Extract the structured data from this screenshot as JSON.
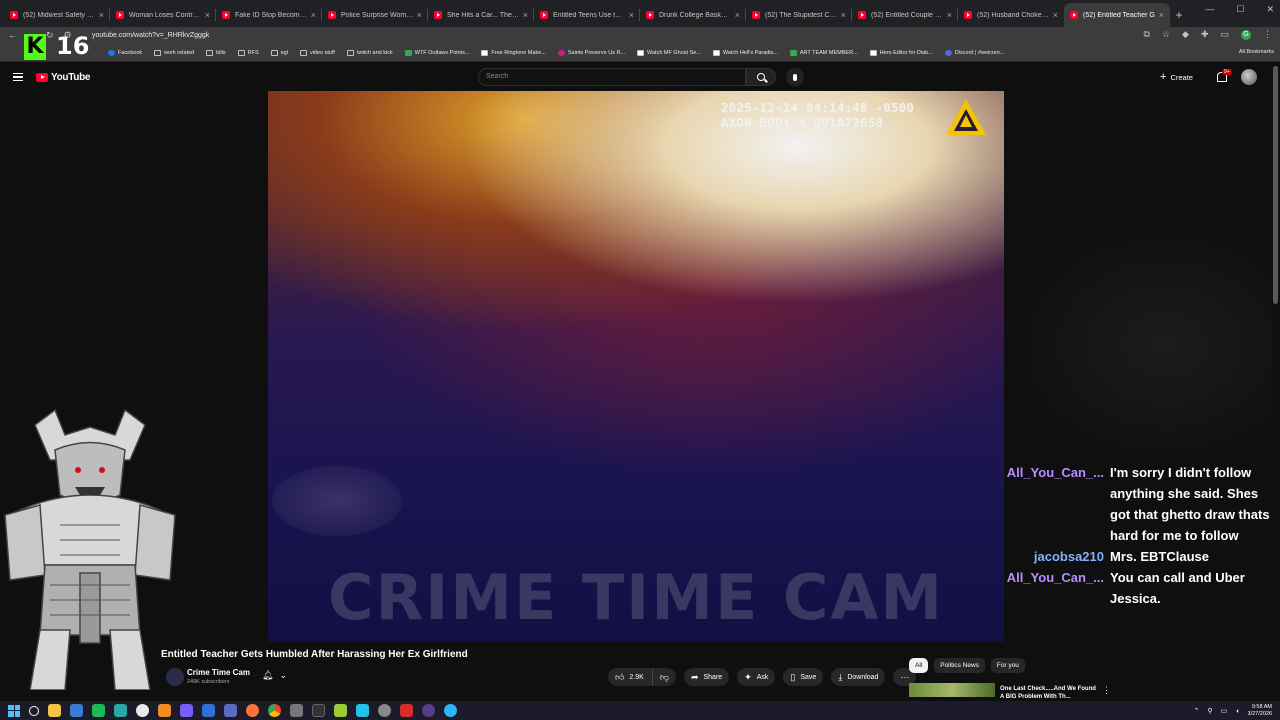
{
  "browser": {
    "tabs": [
      {
        "label": "(52) Midwest Safety - You"
      },
      {
        "label": "Woman Loses Control and"
      },
      {
        "label": "Fake ID Stop Becomes a F"
      },
      {
        "label": "Police Surprise Woman Co"
      },
      {
        "label": "She Hits a Car... Then Pre"
      },
      {
        "label": "Entitled Teens Use the Ra"
      },
      {
        "label": "Drunk College Basketball"
      },
      {
        "label": "(52) The Stupidest Crimin"
      },
      {
        "label": "(52) Entitled Couple Mee"
      },
      {
        "label": "(52) Husband Chokes Wif"
      },
      {
        "label": "(52) Entitled Teacher G"
      }
    ],
    "new_tab": "+",
    "url": "youtube.com/watch?v=_RHRkvZgggk",
    "bookmarks": [
      {
        "label": "Facebook",
        "icon": "fb"
      },
      {
        "label": "work related",
        "icon": "folder"
      },
      {
        "label": "bills",
        "icon": "folder"
      },
      {
        "label": "RFS",
        "icon": "folder"
      },
      {
        "label": "egl",
        "icon": "folder"
      },
      {
        "label": "video stuff",
        "icon": "folder"
      },
      {
        "label": "twitch and kick",
        "icon": "folder"
      },
      {
        "label": "WTF Outlaws Points...",
        "icon": "g"
      },
      {
        "label": "Free Ringtone Make...",
        "icon": "w"
      },
      {
        "label": "Saints Preserve Us R...",
        "icon": "p"
      },
      {
        "label": "Watch MF Ghost Se...",
        "icon": "w"
      },
      {
        "label": "Watch Hell's Paradis...",
        "icon": "w"
      },
      {
        "label": "ART TEAM MEMBER...",
        "icon": "g"
      },
      {
        "label": "Hero Editor for Diab...",
        "icon": "w"
      },
      {
        "label": "Discord | #welcom...",
        "icon": "d"
      }
    ],
    "all_bookmarks": "All Bookmarks"
  },
  "overlay": {
    "kick_letter": "K",
    "viewer_count": "16"
  },
  "youtube": {
    "logo_text": "YouTube",
    "search_placeholder": "Search",
    "create_label": "Create",
    "notification_count": "9+"
  },
  "video": {
    "timestamp": "2025-12-14 04:14:48 -0500",
    "device": "AXON BODY 4 D01A72658",
    "watermark": "CRIME TIME CAM",
    "title": "Entitled Teacher Gets Humbled After Harassing Her Ex Girlfriend",
    "channel": "Crime Time Cam",
    "subscribers": "249K subscribers",
    "likes": "2.9K",
    "share": "Share",
    "ask": "Ask",
    "save": "Save",
    "download": "Download"
  },
  "chat": [
    {
      "user": "All_You_Can_...",
      "color": "#b88cff",
      "text": "I'm sorry I didn't follow anything she said. Shes got that ghetto draw thats hard for me to follow"
    },
    {
      "user": "jacobsa210",
      "color": "#7fb4ff",
      "text": "Mrs. EBTClause"
    },
    {
      "user": "All_You_Can_...",
      "color": "#b88cff",
      "text": "You can call and Uber Jessica."
    }
  ],
  "sidebar": {
    "chips": [
      "All",
      "Politics News",
      "For you"
    ],
    "rec_title": "One Last Check.....And We Found A BIG Problem With Th..."
  },
  "taskbar": {
    "time": "9:58 AM",
    "date": "3/27/2026"
  }
}
